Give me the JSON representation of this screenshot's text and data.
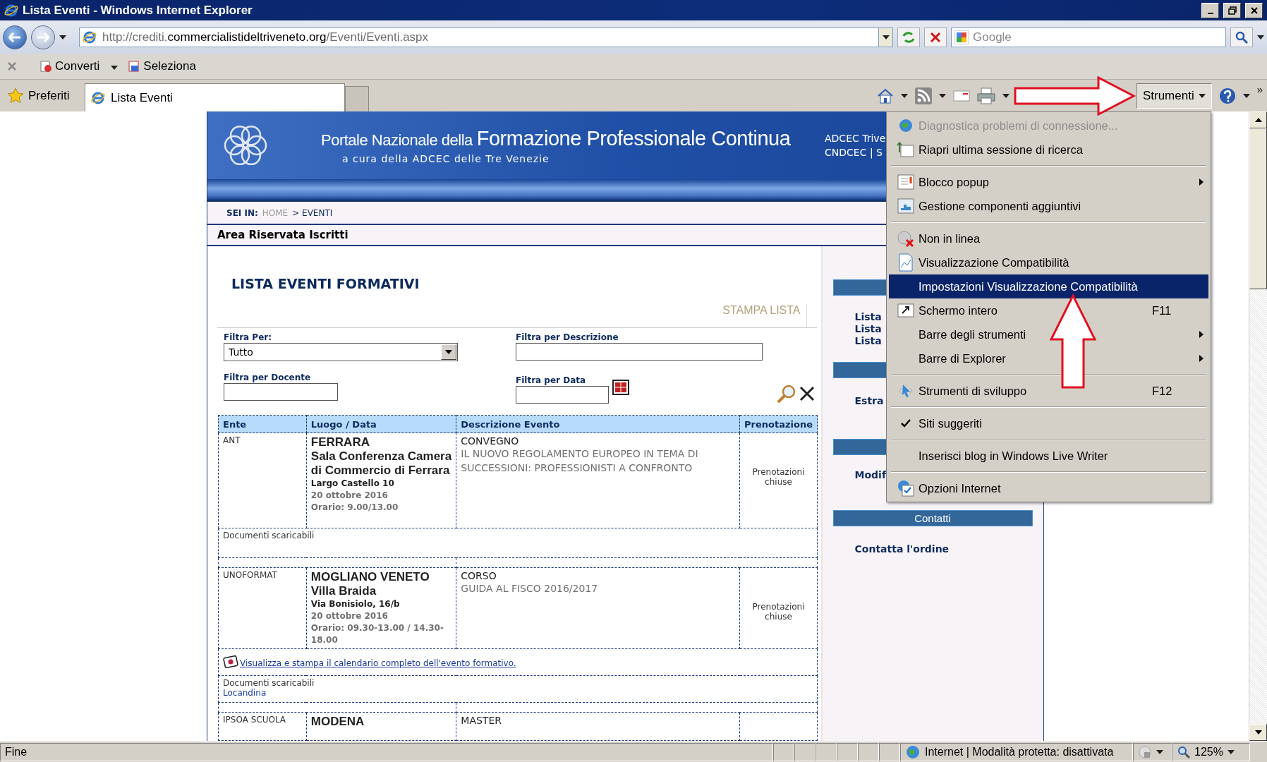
{
  "window": {
    "title": "Lista Eventi - Windows Internet Explorer"
  },
  "address_bar": {
    "url": [
      {
        "text": "http://crediti.",
        "emphasis": false
      },
      {
        "text": "commercialistideltriveneto.org",
        "emphasis": true
      },
      {
        "text": "/Eventi/Eventi.aspx",
        "emphasis": false
      }
    ]
  },
  "search": {
    "placeholder": "Google"
  },
  "command_bar": [
    {
      "label": "Converti",
      "dropdown": true
    },
    {
      "label": "Seleziona",
      "dropdown": false
    }
  ],
  "favorites": {
    "label": "Preferiti"
  },
  "tabs": [
    {
      "label": "Lista Eventi",
      "selected": true
    }
  ],
  "tools_button": {
    "label": "Strumenti",
    "open": true
  },
  "toolbar_overflow": "»",
  "page": {
    "header": {
      "title_small": "Portale Nazionale della",
      "title_large": "Formazione Professionale Continua",
      "subtitle": "a cura della ADCEC delle Tre Venezie",
      "links": [
        "ADCEC Trive",
        "CNDCEC | S"
      ]
    },
    "breadcrumb": {
      "label": "SEI IN:",
      "items": [
        {
          "text": "HOME",
          "current": false
        },
        {
          "text": "> EVENTI",
          "current": true
        }
      ]
    },
    "area_title": "Area Riservata Iscritti",
    "list_title": "LISTA EVENTI FORMATIVI",
    "print_link": "STAMPA LISTA",
    "filters": {
      "filter_by": {
        "label": "Filtra Per:",
        "value": "Tutto"
      },
      "description": {
        "label": "Filtra per Descrizione"
      },
      "teacher": {
        "label": "Filtra per Docente"
      },
      "date": {
        "label": "Filtra per Data"
      }
    },
    "table": {
      "columns": [
        "Ente",
        "Luogo / Data",
        "Descrizione Evento",
        "Prenotazione"
      ],
      "events": [
        {
          "organizer": "ANT",
          "city": "FERRARA",
          "venue": "Sala Conferenza Camera di Commercio di Ferrara",
          "address": "Largo Castello 10",
          "date": "20 ottobre 2016",
          "time": "Orario: 9.00/13.00",
          "type": "CONVEGNO",
          "title": "IL NUOVO REGOLAMENTO EUROPEO IN TEMA DI SUCCESSIONI: PROFESSIONISTI A CONFRONTO",
          "booking": "Prenotazioni chiuse",
          "documents_label": "Documenti scaricabili"
        },
        {
          "organizer": "UNOFORMAT",
          "city": "MOGLIANO VENETO",
          "venue": "Villa Braida",
          "address": "Via Bonisiolo, 16/b",
          "date": "20 ottobre 2016",
          "time": "Orario: 09.30-13.00 / 14.30-18.00",
          "type": "CORSO",
          "title": "GUIDA AL FISCO 2016/2017",
          "booking": "Prenotazioni chiuse",
          "calendar_link": "Visualizza e stampa il calendario completo dell'evento formativo.",
          "documents_label": "Documenti scaricabili",
          "documents": [
            "Locandina"
          ]
        },
        {
          "organizer": "IPSOA SCUOLA",
          "city": "MODENA",
          "type": "MASTER"
        }
      ]
    },
    "sidebar": [
      {
        "links": [
          "Lista",
          "Lista",
          "Lista"
        ]
      },
      {
        "links": [
          "Estra"
        ]
      },
      {
        "links": [
          "Modif"
        ]
      },
      {
        "heading": "Contatti",
        "links": [
          "Contatta l'ordine"
        ]
      }
    ]
  },
  "tools_menu": [
    {
      "kind": "item",
      "label": "Diagnostica problemi di connessione...",
      "disabled": true,
      "selected": false,
      "checked": false,
      "submenu": false
    },
    {
      "kind": "item",
      "label": "Riapri ultima sessione di ricerca",
      "disabled": false,
      "selected": false,
      "checked": false,
      "submenu": false
    },
    {
      "kind": "separator"
    },
    {
      "kind": "item",
      "label": "Blocco popup",
      "disabled": false,
      "selected": false,
      "checked": false,
      "submenu": true
    },
    {
      "kind": "item",
      "label": "Gestione componenti aggiuntivi",
      "disabled": false,
      "selected": false,
      "checked": false,
      "submenu": false
    },
    {
      "kind": "separator"
    },
    {
      "kind": "item",
      "label": "Non in linea",
      "disabled": false,
      "selected": false,
      "checked": false,
      "submenu": false
    },
    {
      "kind": "item",
      "label": "Visualizzazione Compatibilità",
      "disabled": false,
      "selected": false,
      "checked": false,
      "submenu": false
    },
    {
      "kind": "item",
      "label": "Impostazioni Visualizzazione Compatibilità",
      "disabled": false,
      "selected": true,
      "checked": false,
      "submenu": false
    },
    {
      "kind": "item",
      "label": "Schermo intero",
      "shortcut": "F11",
      "disabled": false,
      "selected": false,
      "checked": false,
      "submenu": false
    },
    {
      "kind": "item",
      "label": "Barre degli strumenti",
      "disabled": false,
      "selected": false,
      "checked": false,
      "submenu": true
    },
    {
      "kind": "item",
      "label": "Barre di Explorer",
      "disabled": false,
      "selected": false,
      "checked": false,
      "submenu": true
    },
    {
      "kind": "separator"
    },
    {
      "kind": "item",
      "label": "Strumenti di sviluppo",
      "shortcut": "F12",
      "disabled": false,
      "selected": false,
      "checked": false,
      "submenu": false
    },
    {
      "kind": "separator"
    },
    {
      "kind": "item",
      "label": "Siti suggeriti",
      "disabled": false,
      "selected": false,
      "checked": true,
      "submenu": false
    },
    {
      "kind": "separator"
    },
    {
      "kind": "item",
      "label": "Inserisci blog in Windows Live Writer",
      "disabled": false,
      "selected": false,
      "checked": false,
      "submenu": false
    },
    {
      "kind": "separator"
    },
    {
      "kind": "item",
      "label": "Opzioni Internet",
      "disabled": false,
      "selected": false,
      "checked": false,
      "submenu": false
    }
  ],
  "status_bar": {
    "text": "Fine",
    "zone": "Internet | Modalità protetta: disattivata",
    "zoom": "125%"
  }
}
